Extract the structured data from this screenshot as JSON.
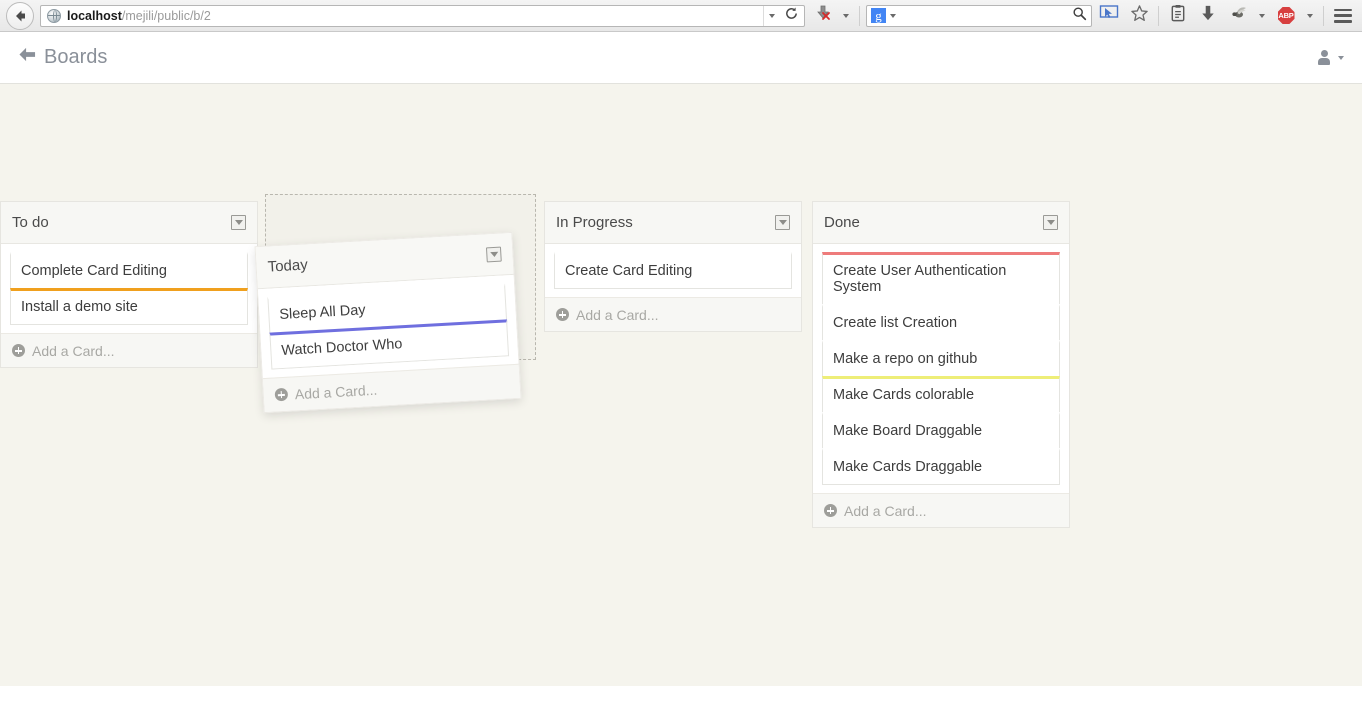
{
  "browser": {
    "back_icon": "back-arrow-icon",
    "url_prefix": "localhost",
    "url_suffix": "/mejili/public/b/2",
    "url_full": "localhost/mejili/public/b/2",
    "site_icon": "globe-icon",
    "url_dropdown_icon": "chevron-down-icon",
    "reload_icon": "reload-icon",
    "download_blocked_icon": "download-cancel-icon",
    "download_blocked_dropdown_icon": "chevron-down-icon",
    "search_engine_logo": "g",
    "search_engine_dropdown_icon": "chevron-down-icon",
    "search_value": "",
    "search_placeholder": "",
    "search_submit_icon": "magnifier-icon",
    "toolbar_icons": [
      {
        "name": "cursor-select-icon"
      },
      {
        "name": "star-bookmark-icon"
      },
      {
        "name": "reading-list-icon"
      },
      {
        "name": "downloads-icon"
      },
      {
        "name": "firebug-icon"
      },
      {
        "name": "firebug-dropdown-icon"
      },
      {
        "name": "adblock-plus-icon",
        "label": "ABP"
      },
      {
        "name": "adblock-plus-dropdown-icon"
      },
      {
        "name": "menu-hamburger-icon"
      }
    ]
  },
  "app_header": {
    "back_icon": "back-arrow-icon",
    "boards_label": "Boards",
    "user_icon": "user-avatar-icon",
    "user_dropdown_icon": "chevron-down-icon"
  },
  "colors": {
    "page_background": "#f5f4ed",
    "card_orange": "#f0a01e",
    "card_blue": "#6f6fdf",
    "card_red": "#ee7b7b",
    "card_yellow": "#eeee78",
    "accent_link": "#8a9099"
  },
  "board": {
    "add_card_label": "Add a Card...",
    "list_menu_icon": "list-menu-dropdown-icon",
    "add_card_icon": "plus-circle-icon",
    "lists": [
      {
        "title": "To do",
        "cards": [
          {
            "text": "Complete Card Editing",
            "color": "none"
          },
          {
            "text": "Install a demo site",
            "color": "#f0a01e"
          }
        ]
      },
      {
        "title": "Today",
        "dragging": true,
        "cards": [
          {
            "text": "Sleep All Day",
            "color": "none"
          },
          {
            "text": "Watch Doctor Who",
            "color": "#6f6fdf"
          }
        ]
      },
      {
        "title": "In Progress",
        "cards": [
          {
            "text": "Create Card Editing",
            "color": "none"
          }
        ]
      },
      {
        "title": "Done",
        "cards": [
          {
            "text": "Create User Authentication System",
            "color": "#ee7b7b"
          },
          {
            "text": "Create list Creation",
            "color": "none"
          },
          {
            "text": "Make a repo on github",
            "color": "none"
          },
          {
            "text": "Make Cards colorable",
            "color": "#eeee78"
          },
          {
            "text": "Make Board Draggable",
            "color": "none"
          },
          {
            "text": "Make Cards Draggable",
            "color": "none"
          }
        ]
      }
    ]
  }
}
